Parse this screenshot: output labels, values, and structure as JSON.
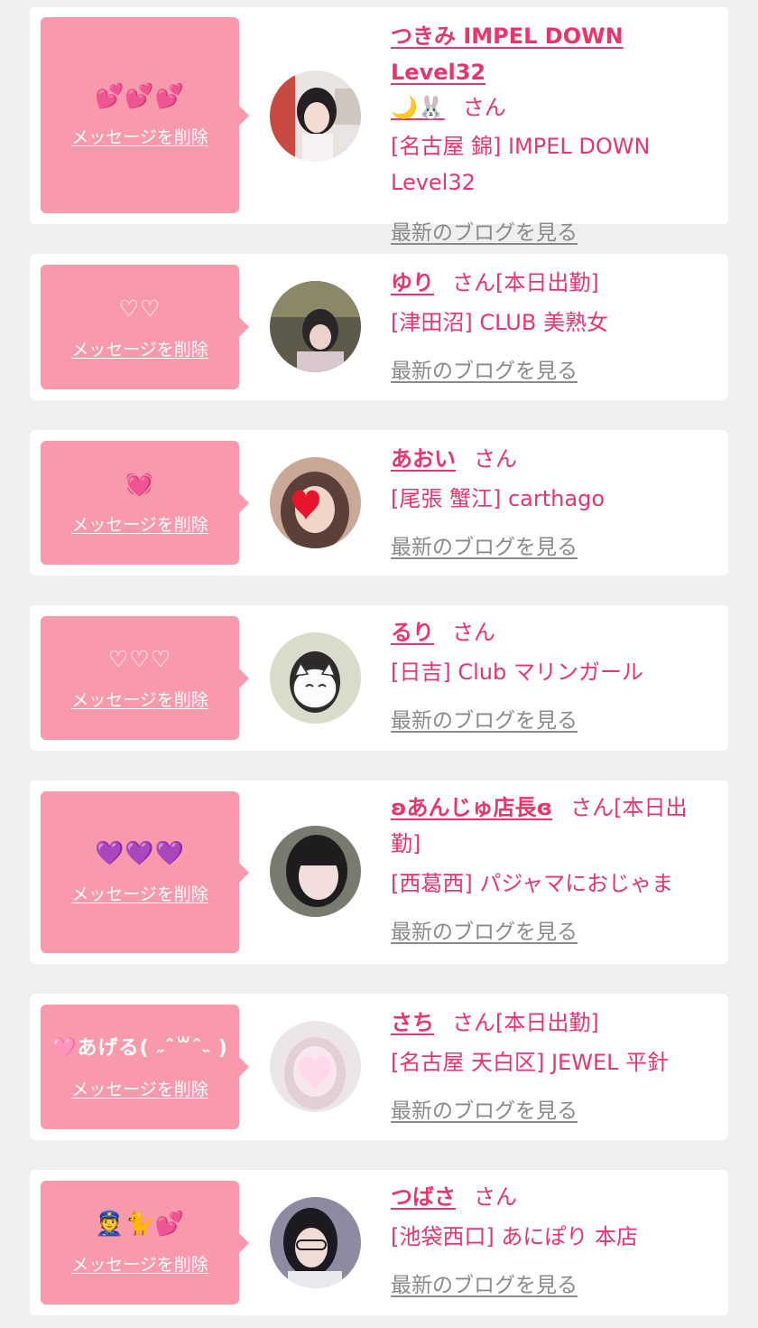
{
  "delete_label": "メッセージを削除",
  "blog_label": "最新のブログを見る",
  "san_suffix": "さん",
  "colors": {
    "accent_pink": "#e8366c",
    "message_box": "#f99aac",
    "blog_link": "#8a8a8a",
    "background": "#efefef"
  },
  "items": [
    {
      "name": "つきみ IMPEL DOWN Level32",
      "name_suffix_emoji": "🌙🐰",
      "suffix": "",
      "shop": "[名古屋 錦] IMPEL DOWN Level32",
      "message_emoji": "💕💕💕",
      "avatar_icon": "photo-avatar-icon"
    },
    {
      "name": "ゆり",
      "name_suffix_emoji": "",
      "suffix": "[本日出勤]",
      "shop": "[津田沼] CLUB 美熟女",
      "message_emoji": "♡♡",
      "avatar_icon": "photo-avatar-icon"
    },
    {
      "name": "あおい",
      "name_suffix_emoji": "",
      "suffix": "",
      "shop": "[尾張 蟹江] carthago",
      "message_emoji": "💓",
      "avatar_icon": "heart-face-cover-icon"
    },
    {
      "name": "るり",
      "name_suffix_emoji": "",
      "suffix": "",
      "shop": "[日吉] Club マリンガール",
      "message_emoji": "♡♡♡",
      "avatar_icon": "cat-face-cover-icon"
    },
    {
      "name": "ʚあんじゅ店長ɞ",
      "name_suffix_emoji": "",
      "suffix": "[本日出勤]",
      "shop": "[西葛西] パジャマにおじゃま",
      "message_emoji": "💜💜💜",
      "avatar_icon": "photo-avatar-icon"
    },
    {
      "name": "さち",
      "name_suffix_emoji": "",
      "suffix": "[本日出勤]",
      "shop": "[名古屋 天白区] JEWEL 平針",
      "message_emoji": "🩷あげる( ˶ˆ꒳ˆ˵ )",
      "avatar_icon": "heart-face-cover-icon"
    },
    {
      "name": "つばさ",
      "name_suffix_emoji": "",
      "suffix": "",
      "shop": "[池袋西口] あにぽり 本店",
      "message_emoji": "👮🐈💕",
      "avatar_icon": "photo-avatar-icon"
    }
  ]
}
